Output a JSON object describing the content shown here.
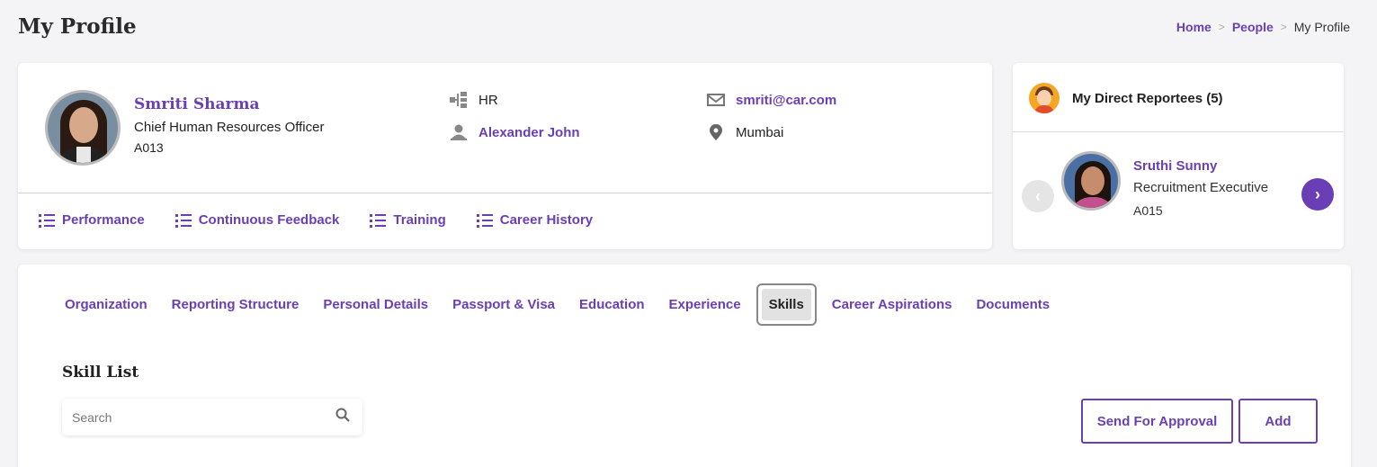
{
  "header": {
    "title": "My Profile",
    "breadcrumb": [
      {
        "label": "Home",
        "link": true
      },
      {
        "label": "People",
        "link": true
      },
      {
        "label": "My Profile",
        "link": false
      }
    ],
    "separator": ">"
  },
  "profile": {
    "name": "Smriti Sharma",
    "title": "Chief Human Resources Officer",
    "employee_id": "A013",
    "department": "HR",
    "manager": "Alexander John",
    "email": "smriti@car.com",
    "location": "Mumbai",
    "quick_links": [
      {
        "label": "Performance",
        "icon": "list-icon"
      },
      {
        "label": "Continuous Feedback",
        "icon": "list-icon"
      },
      {
        "label": "Training",
        "icon": "list-icon"
      },
      {
        "label": "Career History",
        "icon": "list-icon"
      }
    ]
  },
  "reportees": {
    "heading": "My Direct Reportees (5)",
    "current": {
      "name": "Sruthi Sunny",
      "role": "Recruitment Executive",
      "employee_id": "A015"
    },
    "prev_icon": "chevron-left-icon",
    "next_icon": "chevron-right-icon"
  },
  "tabs": [
    {
      "label": "Organization",
      "active": false
    },
    {
      "label": "Reporting Structure",
      "active": false
    },
    {
      "label": "Personal Details",
      "active": false
    },
    {
      "label": "Passport & Visa",
      "active": false
    },
    {
      "label": "Education",
      "active": false
    },
    {
      "label": "Experience",
      "active": false
    },
    {
      "label": "Skills",
      "active": true
    },
    {
      "label": "Career Aspirations",
      "active": false
    },
    {
      "label": "Documents",
      "active": false
    }
  ],
  "skills": {
    "section_title": "Skill List",
    "search": {
      "placeholder": "Search",
      "value": ""
    },
    "send_for_approval_label": "Send For Approval",
    "add_label": "Add"
  },
  "colors": {
    "accent": "#6a3fb5",
    "background": "#f4f4f6",
    "active_tab_bg": "#e2e2e2"
  }
}
